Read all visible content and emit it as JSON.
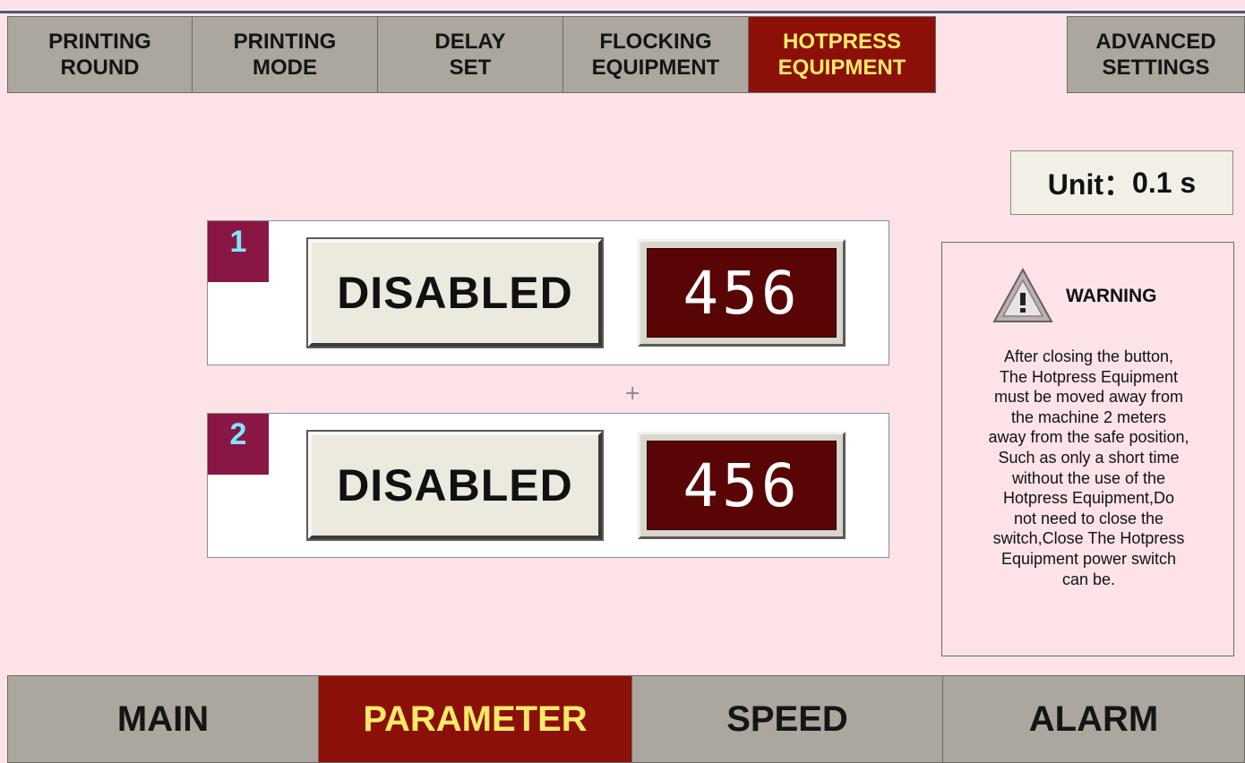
{
  "tabs": [
    {
      "line1": "PRINTING",
      "line2": "ROUND"
    },
    {
      "line1": "PRINTING",
      "line2": "MODE"
    },
    {
      "line1": "DELAY",
      "line2": "SET"
    },
    {
      "line1": "FLOCKING",
      "line2": "EQUIPMENT"
    },
    {
      "line1": "HOTPRESS",
      "line2": "EQUIPMENT",
      "active": true
    },
    {
      "line1": "ADVANCED",
      "line2": "SETTINGS"
    }
  ],
  "unit": {
    "label": "Unit：",
    "value": "0.1 s"
  },
  "rows": [
    {
      "number": "1",
      "button_label": "DISABLED",
      "value": "456"
    },
    {
      "number": "2",
      "button_label": "DISABLED",
      "value": "456"
    }
  ],
  "crosshair": "+",
  "warning": {
    "title": "WARNING",
    "lines": [
      "After closing the button,",
      "The Hotpress Equipment",
      "must be moved away from",
      "the machine 2 meters",
      "away from the safe position,",
      "Such as only a short time",
      "without the use of the",
      "Hotpress Equipment,Do",
      "not need to close the",
      "switch,Close The Hotpress",
      "Equipment power switch",
      "can be."
    ]
  },
  "bottom_nav": [
    {
      "label": "MAIN"
    },
    {
      "label": "PARAMETER",
      "active": true
    },
    {
      "label": "SPEED"
    },
    {
      "label": "ALARM"
    }
  ],
  "colors": {
    "background": "#fde3e8",
    "tab_gray": "#aba69e",
    "active_red": "#8b1007",
    "active_text": "#ffe96a",
    "display_bg": "#5a0505",
    "badge": "#8a1646",
    "badge_text": "#7fe6ff"
  },
  "icons": {
    "warning": "warning-triangle-icon"
  }
}
